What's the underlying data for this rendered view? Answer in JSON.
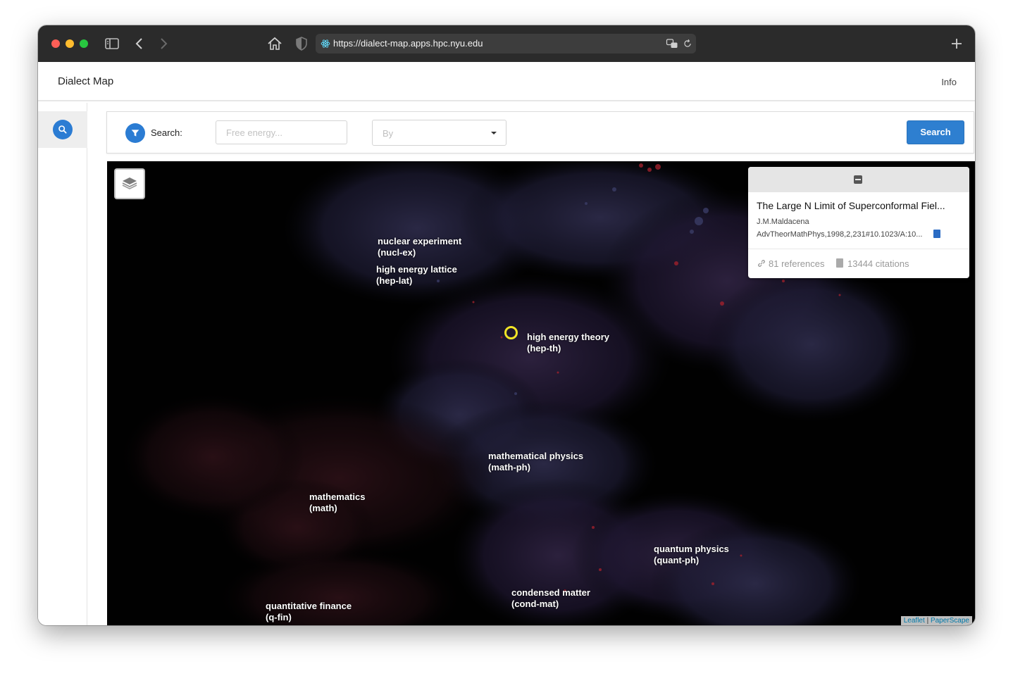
{
  "browser": {
    "url": "https://dialect-map.apps.hpc.nyu.edu"
  },
  "navbar": {
    "brand": "Dialect Map",
    "info": "Info"
  },
  "search": {
    "label": "Search:",
    "placeholder": "Free energy...",
    "by_placeholder": "By",
    "button": "Search"
  },
  "map": {
    "labels": [
      {
        "name": "nuclear experiment",
        "code": "(nucl-ex)"
      },
      {
        "name": "high energy lattice",
        "code": "(hep-lat)"
      },
      {
        "name": "high energy theory",
        "code": "(hep-th)"
      },
      {
        "name": "mathematical physics",
        "code": "(math-ph)"
      },
      {
        "name": "mathematics",
        "code": "(math)"
      },
      {
        "name": "quantum physics",
        "code": "(quant-ph)"
      },
      {
        "name": "condensed matter",
        "code": "(cond-mat)"
      },
      {
        "name": "quantitative finance",
        "code": "(q-fin)"
      }
    ],
    "attribution": {
      "leaflet": "Leaflet",
      "separator": "|",
      "paperscape": "PaperScape"
    },
    "marker_color": "#f2e526"
  },
  "paper_card": {
    "title": "The Large N Limit of Superconformal Fiel...",
    "author": "J.M.Maldacena",
    "journal": "AdvTheorMathPhys,1998,2,231#10.1023/A:10...",
    "references": "81 references",
    "citations": "13444 citations"
  },
  "colors": {
    "accent": "#2e7fd0",
    "titlebar": "#2b2b2b"
  }
}
